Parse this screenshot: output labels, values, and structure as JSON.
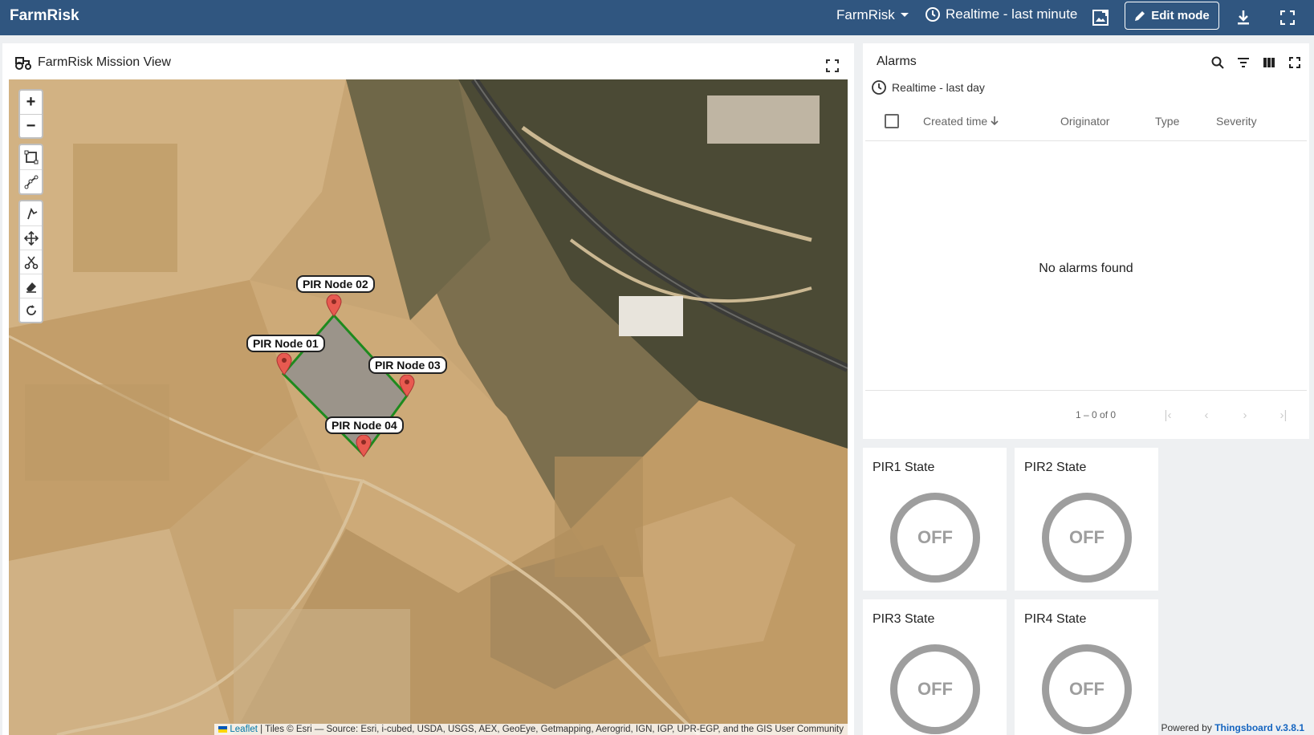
{
  "topbar": {
    "brand": "FarmRisk",
    "dashboard_selector": "FarmRisk",
    "timewindow": "Realtime - last minute",
    "edit_mode_label": "Edit mode"
  },
  "map_widget": {
    "title": "FarmRisk Mission View",
    "markers": [
      {
        "label": "PIR Node 02"
      },
      {
        "label": "PIR Node 01"
      },
      {
        "label": "PIR Node 03"
      },
      {
        "label": "PIR Node 04"
      }
    ],
    "zoom_in": "+",
    "zoom_out": "−",
    "attribution": {
      "leaflet": "Leaflet",
      "text": "| Tiles © Esri — Source: Esri, i-cubed, USDA, USGS, AEX, GeoEye, Getmapping, Aerogrid, IGN, IGP, UPR-EGP, and the GIS User Community"
    },
    "polygon_color": "#1e8a1e",
    "marker_color": "#e85a50"
  },
  "alarms_widget": {
    "title": "Alarms",
    "timewindow": "Realtime - last day",
    "columns": [
      "Created time",
      "Originator",
      "Type",
      "Severity"
    ],
    "empty_text": "No alarms found",
    "page_range": "1 – 0 of 0"
  },
  "pir_cards": [
    {
      "title": "PIR1 State",
      "value": "OFF"
    },
    {
      "title": "PIR2 State",
      "value": "OFF"
    },
    {
      "title": "PIR3 State",
      "value": "OFF"
    },
    {
      "title": "PIR4 State",
      "value": "OFF"
    }
  ],
  "footer": {
    "powered_by": "Powered by",
    "product": "Thingsboard v.3.8.1"
  },
  "colors": {
    "topbar": "#305680",
    "ring": "#9e9e9e"
  }
}
